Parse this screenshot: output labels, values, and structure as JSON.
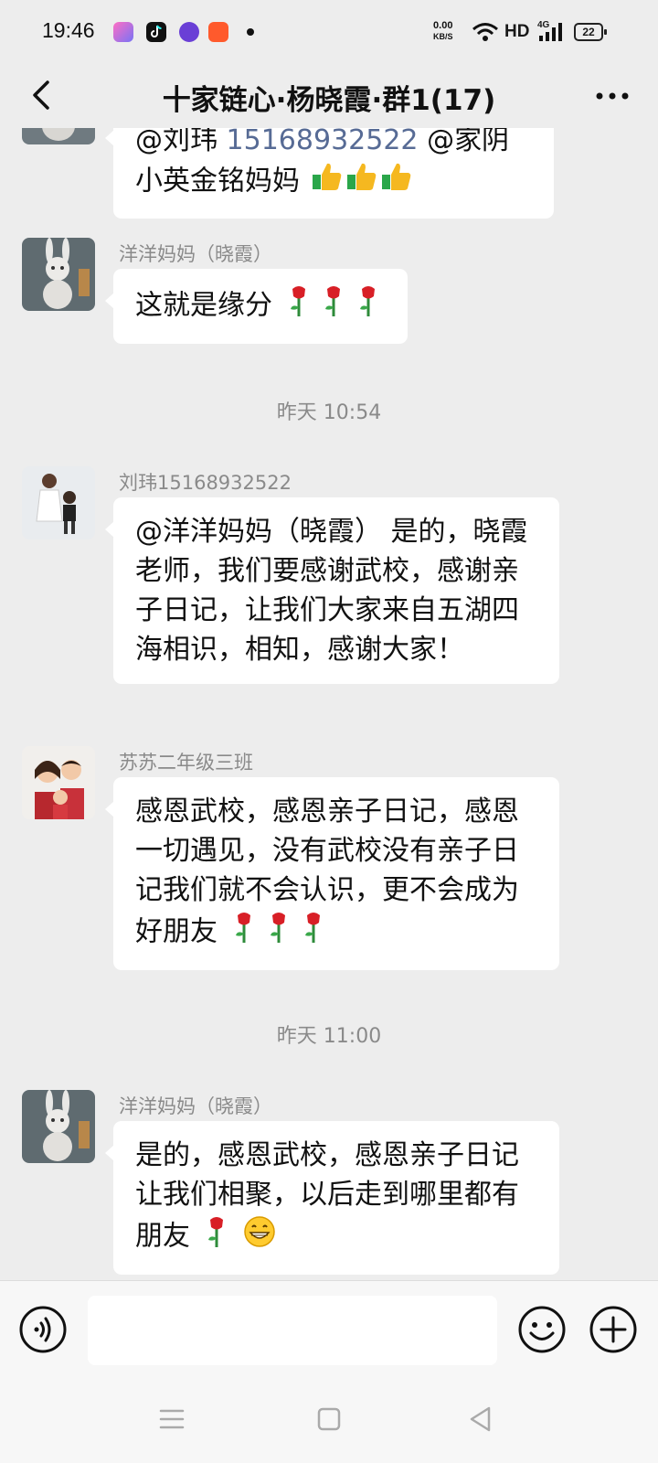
{
  "status_bar": {
    "time": "19:46",
    "net_speed_value": "0.00",
    "net_speed_unit": "KB/S",
    "hd": "HD",
    "network": "4G",
    "battery": "22"
  },
  "header": {
    "title": "十家链心·杨晓霞·群1(17)",
    "back_icon": "chevron-left-icon",
    "more_icon": "more-dots-icon"
  },
  "messages": [
    {
      "line1_prefix": "@刘玮",
      "line1_number": "15168932522",
      "line1_suffix": "@家阴",
      "line2_text": "小英金铭妈妈",
      "emoji": "thumbs-up-icon"
    },
    {
      "sender": "洋洋妈妈（晓霞）",
      "text": "这就是缘分",
      "emoji": "rose-icon"
    },
    {
      "time_label": "昨天 10:54"
    },
    {
      "sender": "刘玮15168932522",
      "text": "@洋洋妈妈（晓霞） 是的，晓霞老师，我们要感谢武校，感谢亲子日记，让我们大家来自五湖四海相识，相知，感谢大家！"
    },
    {
      "sender": "苏苏二年级三班",
      "text": "感恩武校，感恩亲子日记，感恩一切遇见，没有武校没有亲子日记我们就不会认识，更不会成为好朋友",
      "emoji": "rose-icon"
    },
    {
      "time_label": "昨天 11:00"
    },
    {
      "sender": "洋洋妈妈（晓霞）",
      "text": "是的，感恩武校，感恩亲子日记让我们相聚，以后走到哪里都有朋友",
      "emoji": "grin-icon"
    }
  ],
  "input_bar": {
    "placeholder": "",
    "voice_icon": "voice-icon",
    "emoji_icon": "smiley-icon",
    "plus_icon": "plus-icon"
  },
  "nav_bar": {
    "menu_icon": "menu-icon",
    "home_icon": "home-square-icon",
    "back_icon": "back-triangle-icon"
  },
  "colors": {
    "background": "#ededed",
    "bubble": "#ffffff",
    "mention": "#576b95",
    "meta_text": "#8a8a8a"
  }
}
